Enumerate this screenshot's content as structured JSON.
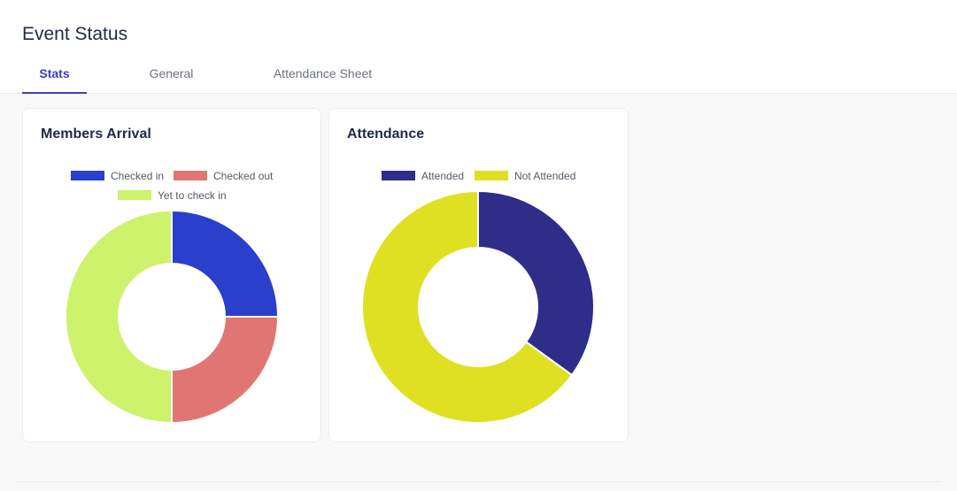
{
  "page": {
    "title": "Event Status"
  },
  "tabs": [
    {
      "label": "Stats",
      "active": true
    },
    {
      "label": "General",
      "active": false
    },
    {
      "label": "Attendance Sheet",
      "active": false
    }
  ],
  "colors": {
    "accent": "#3f3db8",
    "checked_in": "#2a3fcc",
    "checked_out": "#e07673",
    "yet_to_check_in": "#cdf26c",
    "attended": "#2e2d8a",
    "not_attended": "#dfe022"
  },
  "chart_data": [
    {
      "type": "pie",
      "title": "Members Arrival",
      "categories": [
        "Checked in",
        "Checked out",
        "Yet to check in"
      ],
      "values": [
        25,
        25,
        50
      ],
      "colors": [
        "#2a3fcc",
        "#e07673",
        "#cdf26c"
      ],
      "donut": true,
      "legend": "top"
    },
    {
      "type": "pie",
      "title": "Attendance",
      "categories": [
        "Attended",
        "Not Attended"
      ],
      "values": [
        35,
        65
      ],
      "colors": [
        "#2e2d8a",
        "#dfe022"
      ],
      "donut": true,
      "legend": "top"
    }
  ]
}
